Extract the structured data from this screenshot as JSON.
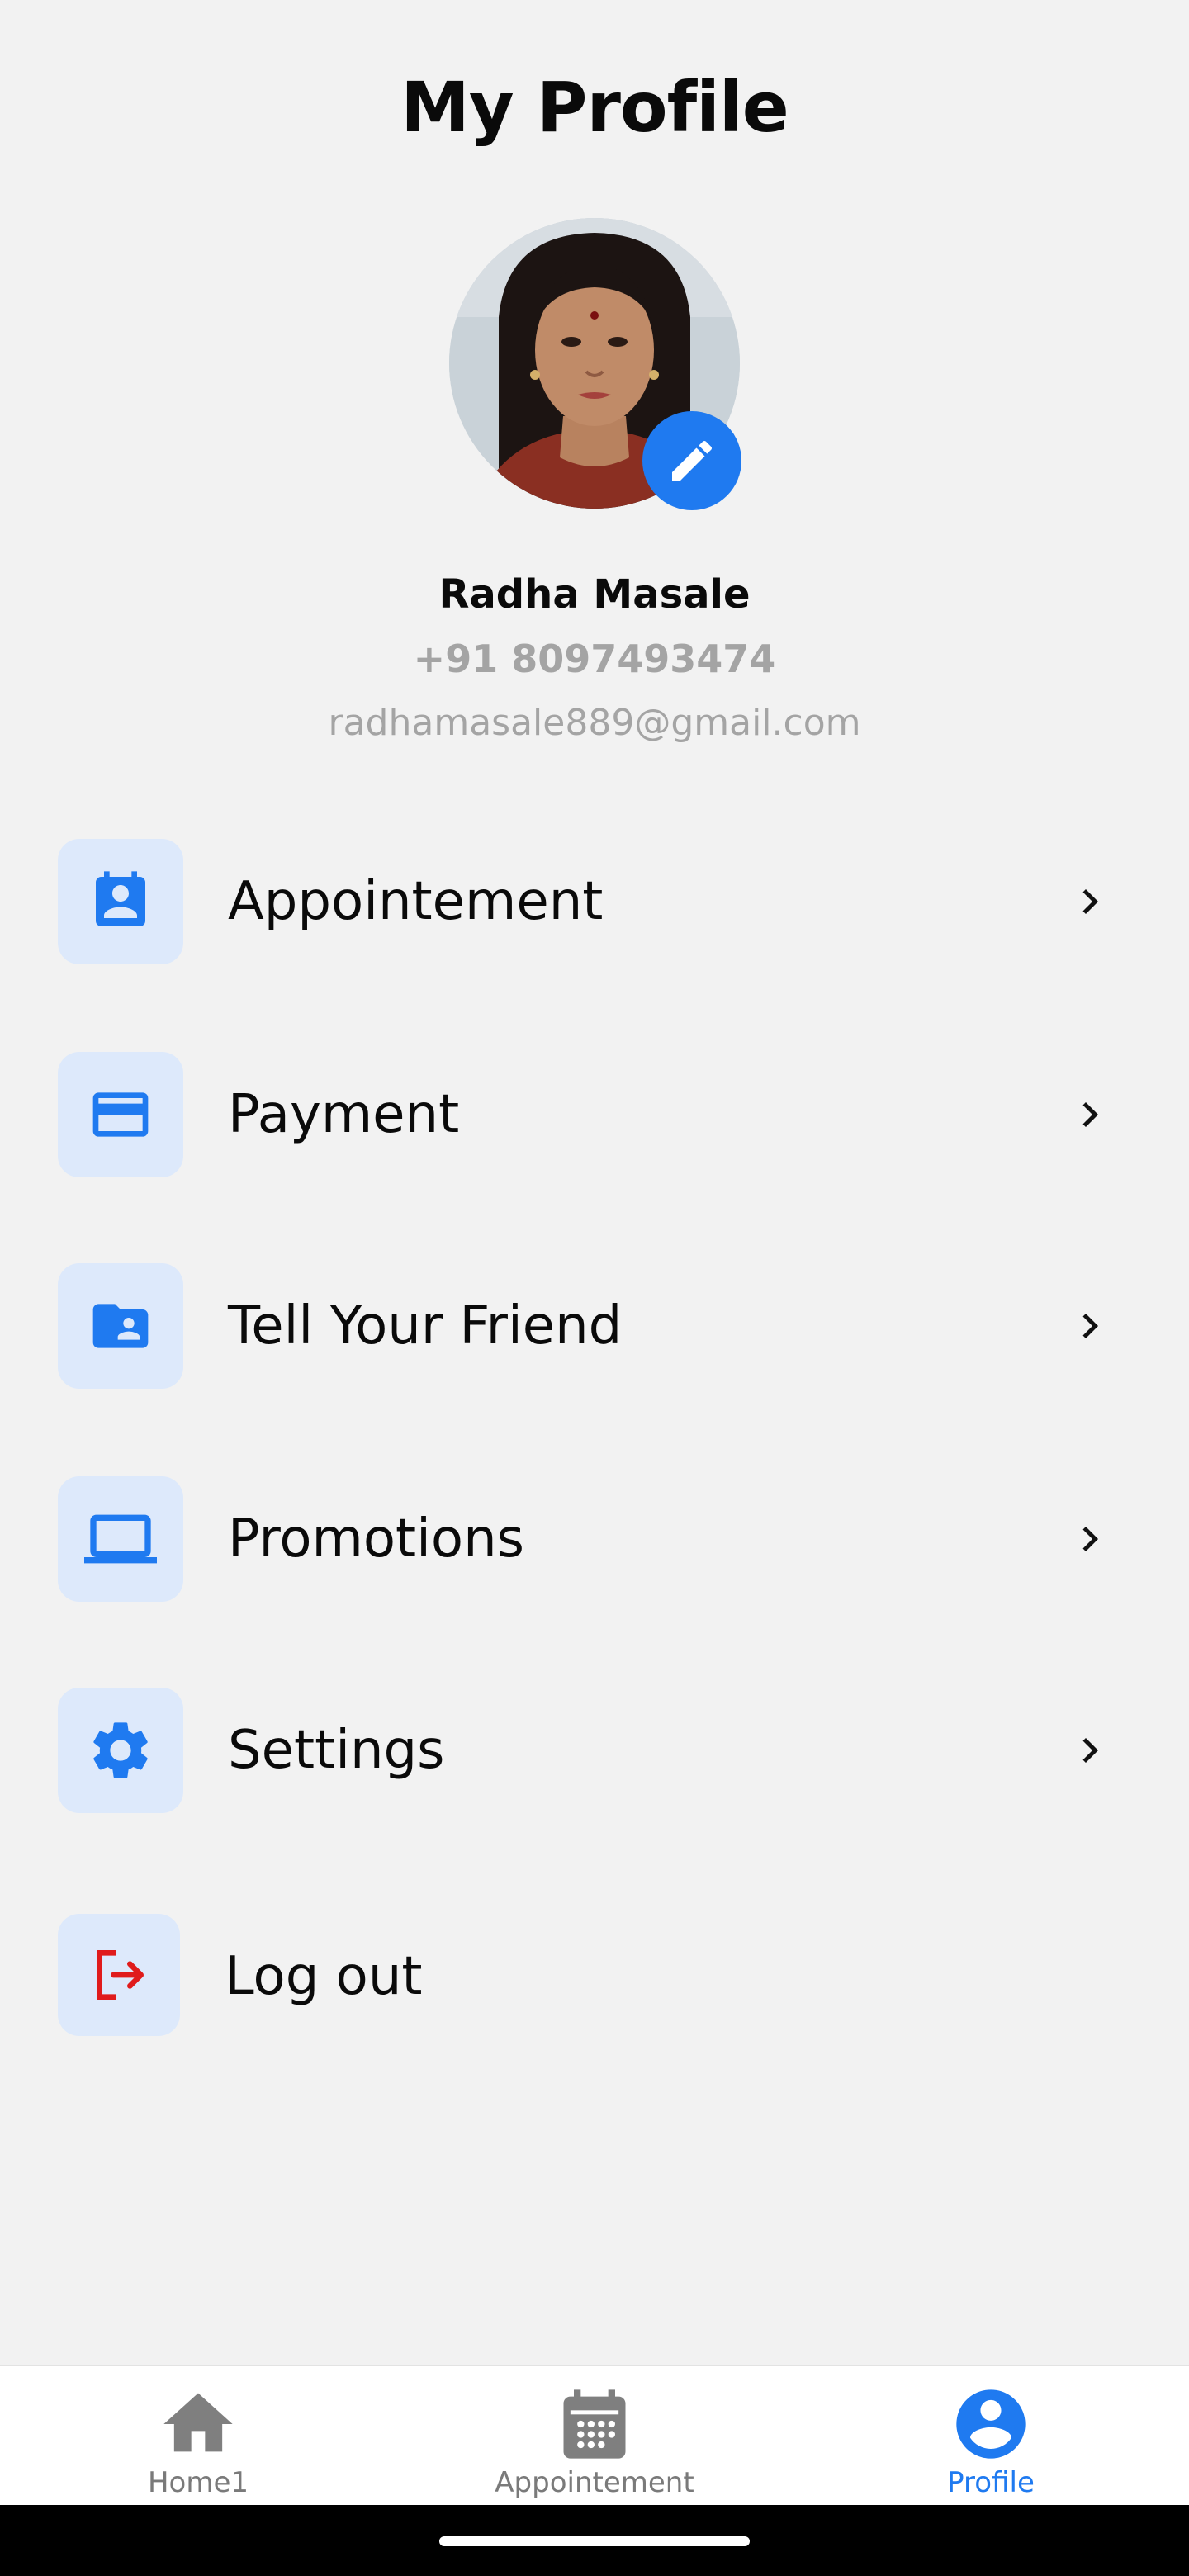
{
  "header": {
    "title": "My Profile"
  },
  "profile": {
    "name": "Radha Masale",
    "phone": "+91 8097493474",
    "email": "radhamasale889@gmail.com",
    "edit_icon": "pencil-icon"
  },
  "menu": {
    "items": [
      {
        "label": "Appointement",
        "icon": "contact-calendar-icon"
      },
      {
        "label": "Payment",
        "icon": "credit-card-icon"
      },
      {
        "label": "Tell Your Friend",
        "icon": "shared-folder-icon"
      },
      {
        "label": "Promotions",
        "icon": "laptop-icon"
      },
      {
        "label": "Settings",
        "icon": "gear-icon"
      },
      {
        "label": "Log out",
        "icon": "logout-icon"
      }
    ]
  },
  "bottom_nav": {
    "items": [
      {
        "label": "Home1",
        "icon": "home-icon",
        "active": false
      },
      {
        "label": "Appointement",
        "icon": "calendar-icon",
        "active": false
      },
      {
        "label": "Profile",
        "icon": "account-circle-icon",
        "active": true
      }
    ]
  },
  "colors": {
    "accent": "#1f7af0",
    "icon_bg": "#dde9fb",
    "logout": "#e01b1b",
    "muted_text": "#a4a4a4",
    "background": "#f2f2f2"
  }
}
